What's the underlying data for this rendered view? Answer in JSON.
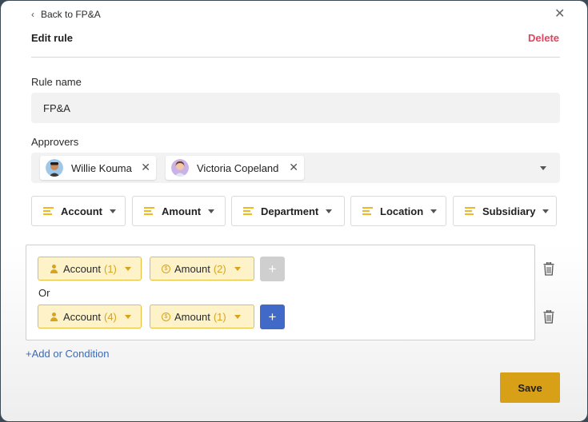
{
  "header": {
    "back_label": "Back to FP&A",
    "title": "Edit rule",
    "delete_label": "Delete"
  },
  "rule_name": {
    "label": "Rule name",
    "value": "FP&A"
  },
  "approvers": {
    "label": "Approvers",
    "people": [
      {
        "name": "Willie Kouma"
      },
      {
        "name": "Victoria Copeland"
      }
    ]
  },
  "filters": [
    "Account",
    "Amount",
    "Department",
    "Location",
    "Subsidiary"
  ],
  "conditions": {
    "or_label": "Or",
    "groups": [
      {
        "field1": "Account",
        "count1": "(1)",
        "field2": "Amount",
        "count2": "(2)",
        "add_enabled": false
      },
      {
        "field1": "Account",
        "count1": "(4)",
        "field2": "Amount",
        "count2": "(1)",
        "add_enabled": true
      }
    ],
    "add_or_label": "+Add or Condition"
  },
  "save_label": "Save",
  "colors": {
    "accent": "#d8a017",
    "delete": "#e0445f",
    "link": "#3d69b2",
    "add_button": "#4169c8"
  },
  "icons": {
    "back": "chevron-left-icon",
    "close": "close-icon",
    "filter": "filter-lines-icon",
    "account": "person-icon",
    "amount": "coin-icon",
    "trash": "trash-icon"
  }
}
